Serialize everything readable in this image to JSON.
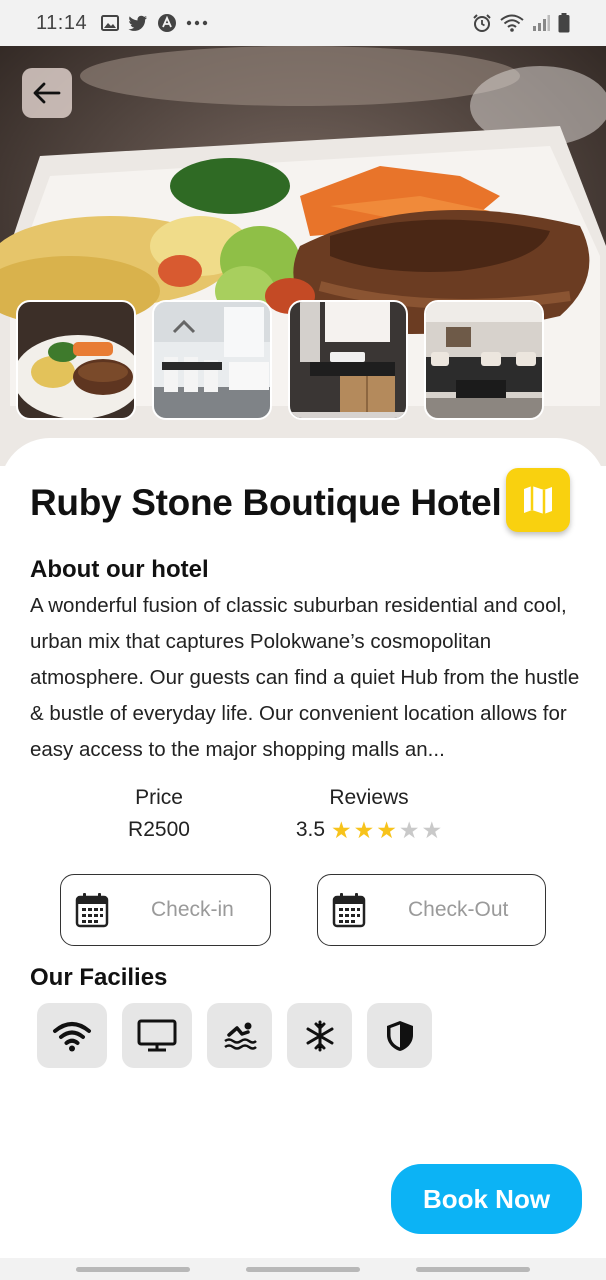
{
  "status_bar": {
    "time": "11:14",
    "left_icons": [
      "image-icon",
      "twitter-icon",
      "app-icon",
      "more-dots-icon"
    ],
    "right_icons": [
      "alarm-icon",
      "wifi-icon",
      "signal-icon",
      "battery-icon"
    ]
  },
  "hero": {
    "back_icon": "arrow-left-icon",
    "thumbnails": [
      "food-plate",
      "restaurant-dining",
      "bathroom-vanity",
      "lounge-seating"
    ]
  },
  "hotel": {
    "name": "Ruby Stone Boutique Hotel",
    "map_icon": "map-icon",
    "map_color": "#f9d10f"
  },
  "about": {
    "title": "About our hotel",
    "text": "A wonderful fusion of classic suburban residential and cool, urban mix that captures Polokwane’s cosmopolitan atmosphere. Our guests can find a quiet Hub from the hustle & bustle of everyday life. Our convenient location allows for easy access to the major shopping malls an..."
  },
  "price": {
    "label": "Price",
    "value": "R2500"
  },
  "reviews": {
    "label": "Reviews",
    "rating": "3.5",
    "stars_filled": 3,
    "stars_total": 5,
    "star_color": "#f7c31b"
  },
  "dates": {
    "checkin_label": "Check-in",
    "checkout_label": "Check-Out",
    "icon": "calendar-icon"
  },
  "facilities": {
    "title": "Our Facilies",
    "items": [
      "wifi-icon",
      "tv-icon",
      "pool-icon",
      "ac-snowflake-icon",
      "security-shield-icon"
    ]
  },
  "book": {
    "label": "Book Now",
    "color": "#0cb3f5"
  }
}
